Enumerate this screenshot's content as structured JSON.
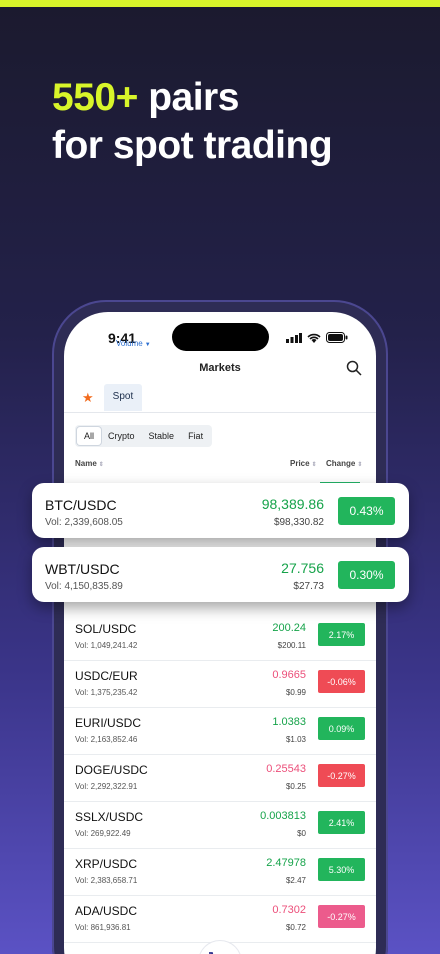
{
  "headline": {
    "accent": "550+",
    "rest_line1": " pairs",
    "line2": "for spot trading"
  },
  "status": {
    "time": "9:41"
  },
  "header": {
    "title": "Markets"
  },
  "tabs": {
    "spot": "Spot"
  },
  "filters": [
    "All",
    "Crypto",
    "Stable",
    "Fiat"
  ],
  "columns": {
    "name": "Name",
    "volume": "Volume",
    "price": "Price",
    "change": "Change"
  },
  "highlighted": [
    {
      "pair": "BTC/USDC",
      "vol": "Vol: 2,339,608.05",
      "price": "98,389.86",
      "usd": "$98,330.82",
      "change": "0.43%"
    },
    {
      "pair": "WBT/USDC",
      "vol": "Vol: 4,150,835.89",
      "price": "27.756",
      "usd": "$27.73",
      "change": "0.30%"
    }
  ],
  "rows": [
    {
      "pair": "SOL/USDC",
      "vol": "Vol: 1,049,241.42",
      "price": "200.24",
      "usd": "$200.11",
      "change": "2.17%",
      "dir": "up"
    },
    {
      "pair": "USDC/EUR",
      "vol": "Vol: 1,375,235.42",
      "price": "0.9665",
      "usd": "$0.99",
      "change": "-0.06%",
      "dir": "down"
    },
    {
      "pair": "EURI/USDC",
      "vol": "Vol: 2,163,852.46",
      "price": "1.0383",
      "usd": "$1.03",
      "change": "0.09%",
      "dir": "up"
    },
    {
      "pair": "DOGE/USDC",
      "vol": "Vol: 2,292,322.91",
      "price": "0.25543",
      "usd": "$0.25",
      "change": "-0.27%",
      "dir": "down"
    },
    {
      "pair": "SSLX/USDC",
      "vol": "Vol: 269,922.49",
      "price": "0.003813",
      "usd": "$0",
      "change": "2.41%",
      "dir": "up"
    },
    {
      "pair": "XRP/USDC",
      "vol": "Vol: 2,383,658.71",
      "price": "2.47978",
      "usd": "$2.47",
      "change": "5.30%",
      "dir": "up"
    },
    {
      "pair": "ADA/USDC",
      "vol": "Vol: 861,936.81",
      "price": "0.7302",
      "usd": "$0.72",
      "change": "-0.27%",
      "dir": "pink"
    }
  ],
  "colors": {
    "accent": "#d8f52a",
    "up": "#22b55c",
    "down": "#ef4b55"
  }
}
